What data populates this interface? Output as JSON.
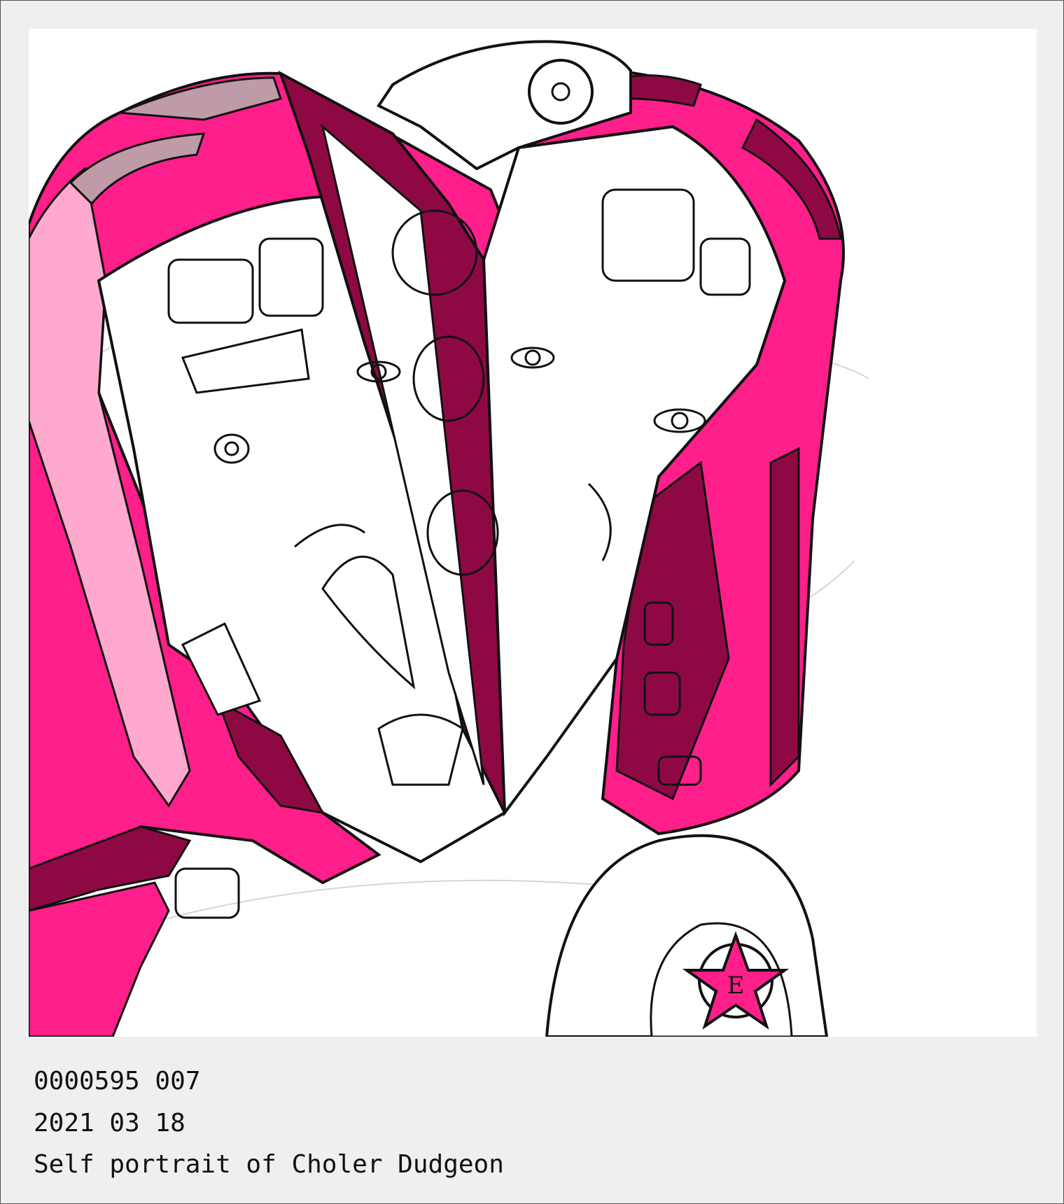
{
  "artwork": {
    "icon": "line-art-self-portrait",
    "badge_letter": "E",
    "colors": {
      "hot_pink": "#ff1f8a",
      "maroon": "#8e0944",
      "light_pink": "#ffa9cf",
      "mauve": "#bf9aa8",
      "outline": "#111111",
      "paper": "#ffffff",
      "frame": "#efefef"
    }
  },
  "caption": {
    "id_line": "0000595 007",
    "date_line": "2021 03 18",
    "title_line": "Self portrait of Choler Dudgeon"
  }
}
